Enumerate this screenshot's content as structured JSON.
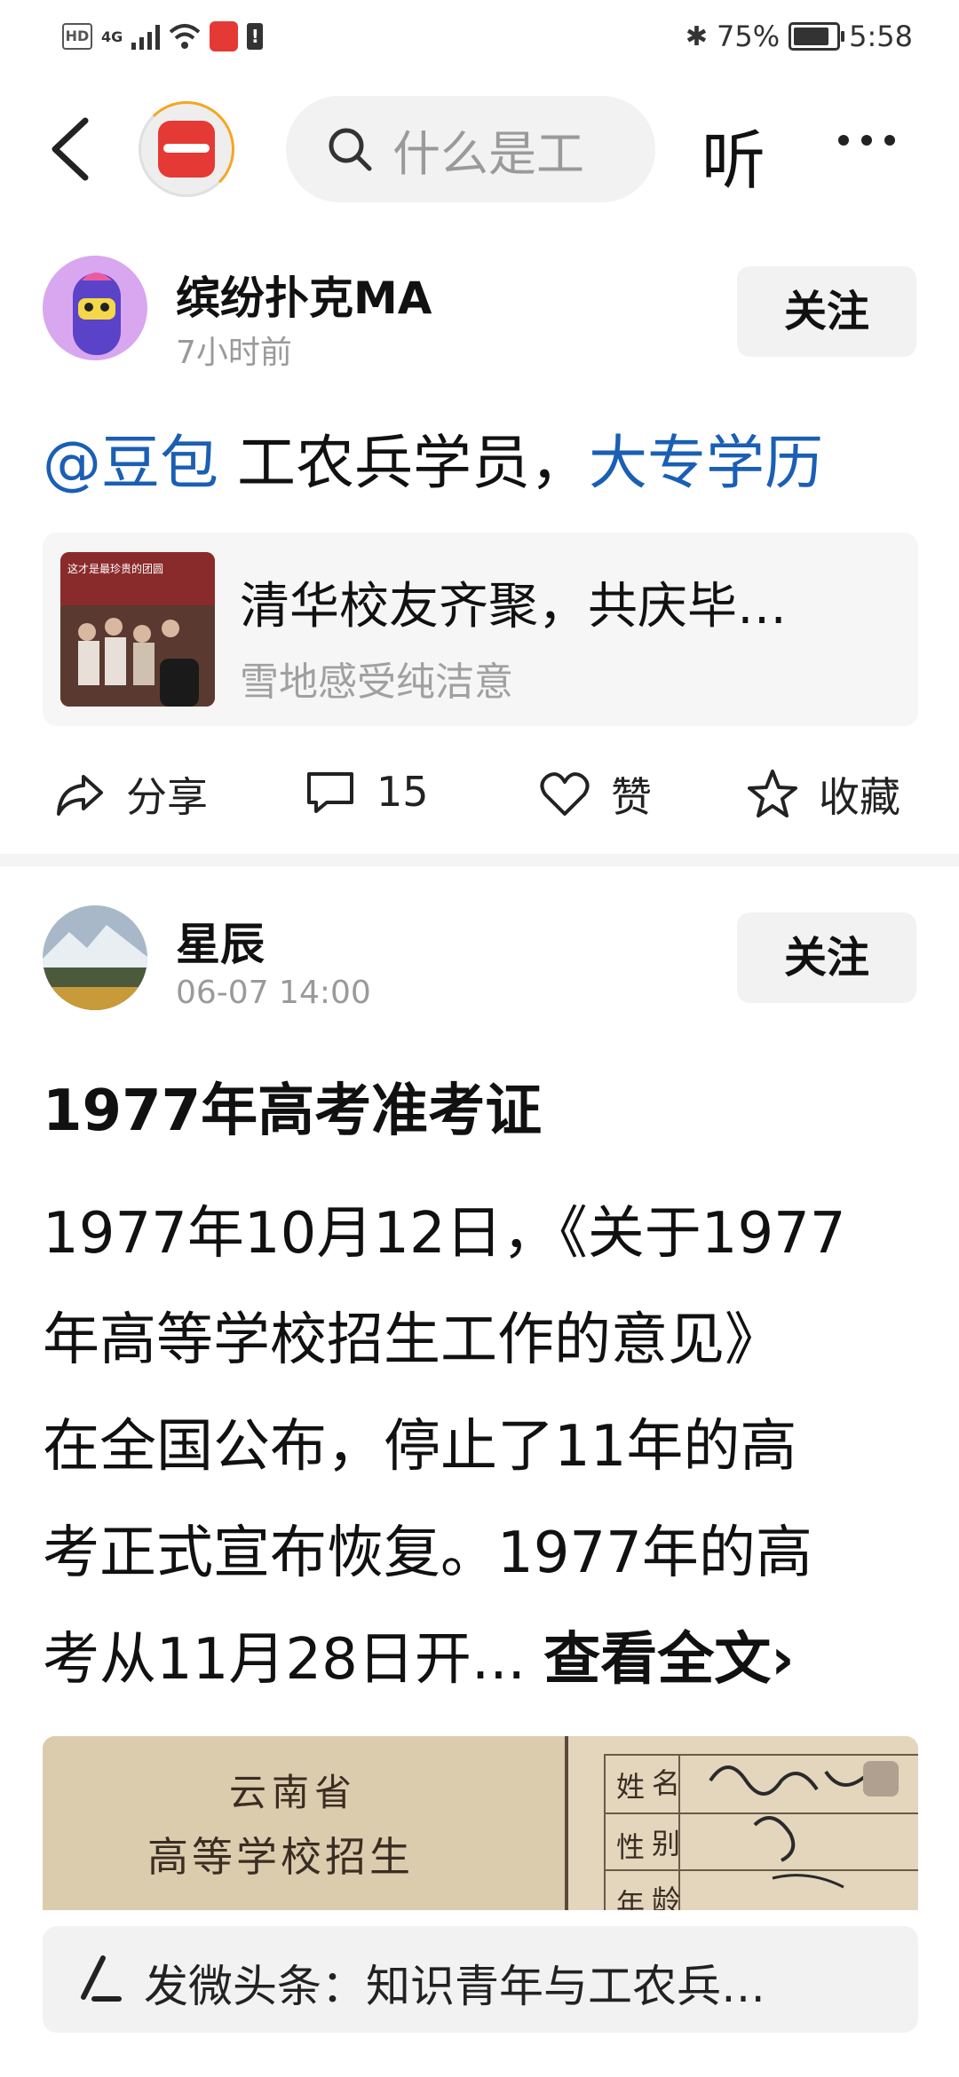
{
  "status_bar": {
    "hd": "HD",
    "network": "4G",
    "battery": "75%",
    "time": "5:58"
  },
  "nav": {
    "search_placeholder": "什么是工",
    "listen_label": "听"
  },
  "post1": {
    "username": "缤纷扑克MA",
    "time": "7小时前",
    "follow_label": "关注",
    "mention": "@豆包",
    "text_plain": " 工农兵学员，",
    "text_link": "大专学历",
    "link_card": {
      "title": "清华校友齐聚，共庆毕…",
      "source": "雪地感受纯洁意",
      "thumb_caption": "这才是最珍贵的团圆"
    },
    "actions": {
      "share": "分享",
      "comments": "15",
      "like": "赞",
      "favorite": "收藏"
    }
  },
  "post2": {
    "username": "星辰",
    "time": "06-07 14:00",
    "follow_label": "关注",
    "title": "1977年高考准考证",
    "body_lines": [
      "1977年10月12日，《关于1977",
      "年高等学校招生工作的意见》",
      "在全国公布，停止了11年的高",
      "考正式宣布恢复。1977年的高"
    ],
    "body_last": "考从11月28日开... ",
    "read_more": "查看全文›",
    "image": {
      "line1": "云南省",
      "line2": "高等学校招生",
      "cells": [
        "姓",
        "名",
        "性",
        "别",
        "年",
        "龄"
      ]
    }
  },
  "composer": {
    "text": "发微头条：知识青年与工农兵…"
  },
  "colors": {
    "link_blue": "#1a5fb4",
    "accent_red": "#e53935",
    "progress_orange": "#f5a623"
  }
}
